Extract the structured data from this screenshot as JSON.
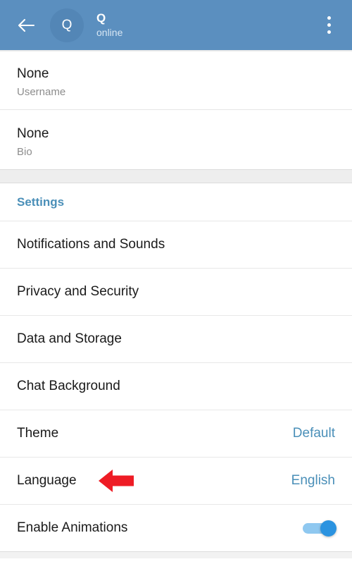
{
  "header": {
    "back_icon": "back-arrow-icon",
    "avatar_letter": "Q",
    "title": "Q",
    "subtitle": "online",
    "menu_icon": "overflow-menu-icon",
    "background_color": "#5b8fbf",
    "avatar_color": "#5386b6"
  },
  "profile": [
    {
      "value": "None",
      "label": "Username"
    },
    {
      "value": "None",
      "label": "Bio"
    }
  ],
  "settings_section": {
    "header": "Settings",
    "header_color": "#4a8fb8",
    "rows": [
      {
        "label": "Notifications and Sounds",
        "value": "",
        "type": "nav"
      },
      {
        "label": "Privacy and Security",
        "value": "",
        "type": "nav"
      },
      {
        "label": "Data and Storage",
        "value": "",
        "type": "nav"
      },
      {
        "label": "Chat Background",
        "value": "",
        "type": "nav"
      },
      {
        "label": "Theme",
        "value": "Default",
        "type": "value"
      },
      {
        "label": "Language",
        "value": "English",
        "type": "value"
      },
      {
        "label": "Enable Animations",
        "value": "",
        "type": "toggle"
      }
    ]
  },
  "annotation": {
    "name": "red-left-arrow-annotation",
    "color": "#ee1c25",
    "points_at": "Language"
  }
}
